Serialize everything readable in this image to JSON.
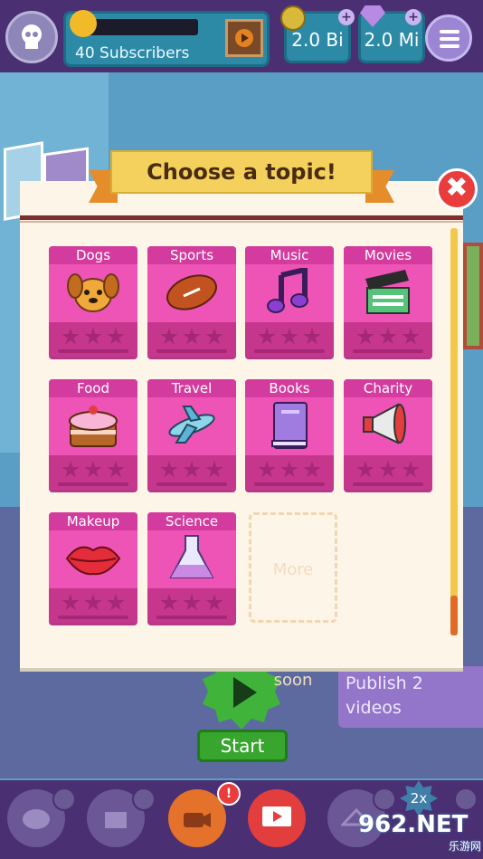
{
  "header": {
    "subscribers_label": "40 Subscribers",
    "views_value": "2.0 Bi",
    "gems_value": "2.0 Mi",
    "plus_symbol": "+"
  },
  "dialog": {
    "title": "Choose a topic!",
    "close_symbol": "✖",
    "topics": [
      {
        "label": "Dogs",
        "icon": "dog-icon",
        "stars": 0
      },
      {
        "label": "Sports",
        "icon": "football-icon",
        "stars": 0
      },
      {
        "label": "Music",
        "icon": "music-note-icon",
        "stars": 0
      },
      {
        "label": "Movies",
        "icon": "clapperboard-icon",
        "stars": 0
      },
      {
        "label": "Food",
        "icon": "cake-icon",
        "stars": 0
      },
      {
        "label": "Travel",
        "icon": "airplane-icon",
        "stars": 0
      },
      {
        "label": "Books",
        "icon": "book-icon",
        "stars": 0
      },
      {
        "label": "Charity",
        "icon": "megaphone-icon",
        "stars": 0
      },
      {
        "label": "Makeup",
        "icon": "lips-icon",
        "stars": 0
      },
      {
        "label": "Science",
        "icon": "flask-icon",
        "stars": 0
      }
    ],
    "more_soon": "More soon"
  },
  "background": {
    "publish_task": "Publish 2 videos",
    "start_label": "Start"
  },
  "bottom_nav": {
    "boost_label": "2x",
    "alert_symbol": "!",
    "watermark_main": "962.NET",
    "watermark_sub": "乐游网"
  },
  "colors": {
    "card_pink": "#ed54b6",
    "card_header": "#d33c9e",
    "banner_yellow": "#f3d15c",
    "close_red": "#e93c3c",
    "start_green": "#38a52f"
  }
}
